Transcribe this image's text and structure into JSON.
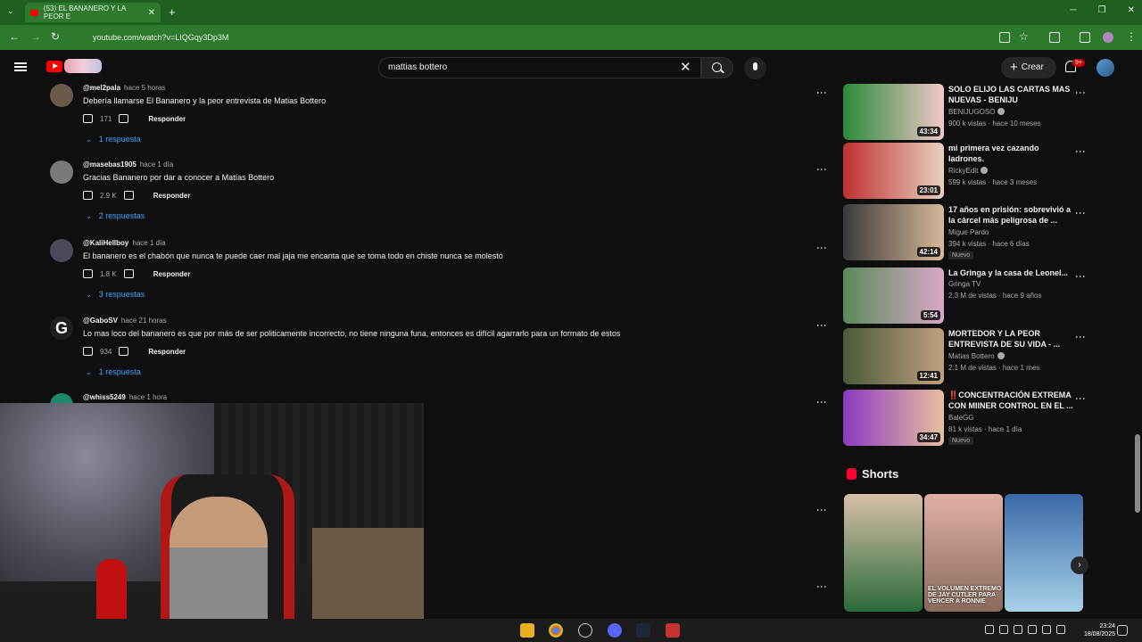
{
  "browser": {
    "tab_title": "(53) EL BANANERO Y LA PEOR E",
    "url": "youtube.com/watch?v=LIQGqy3Dp3M"
  },
  "header": {
    "search_value": "mattias bottero",
    "create_label": "Crear",
    "notif_count": "9+"
  },
  "comments": [
    {
      "user": "@mel2pala",
      "time": "hace 5 horas",
      "text": "Debería llamarse El Bananero y la peor entrevista de Matias Bottero",
      "likes": "171",
      "reply_label": "Responder",
      "replies": "1 respuesta"
    },
    {
      "user": "@masebas1905",
      "time": "hace 1 día",
      "text": "Gracias Bananero por dar a conocer a Matías Bottero",
      "likes": "2.9 K",
      "reply_label": "Responder",
      "replies": "2 respuestas"
    },
    {
      "user": "@KaliHellboy",
      "time": "hace 1 día",
      "text": "El bananero es el chabón que nunca te puede caer mal jaja me encanta que se toma todo en chiste nunca se molestó",
      "likes": "1.8 K",
      "reply_label": "Responder",
      "replies": "3 respuestas"
    },
    {
      "user": "@GaboSV",
      "time": "hace 21 horas",
      "text": "Lo mas loco del bananero es que por más de ser politicamente incorrecto, no tiene ninguna funa, entonces es difícil agarrarlo para un formato de estos",
      "likes": "934",
      "reply_label": "Responder",
      "replies": "1 respuesta"
    },
    {
      "user": "@whiss5249",
      "time": "hace 1 hora",
      "text": "",
      "likes": "",
      "reply_label": "",
      "replies": ""
    }
  ],
  "sidebar_videos": [
    {
      "title": "SOLO ELIJO LAS CARTAS MAS NUEVAS - BENIJU",
      "channel": "BENIJUGOSO",
      "meta": "900 k vistas · hace 10 meses",
      "duration": "43:34",
      "badge": "",
      "thumb_colors": [
        "#2a8a3a",
        "#f0c8c8"
      ]
    },
    {
      "title": "mi primera vez cazando ladrones.",
      "channel": "RickyEdit",
      "meta": "599 k vistas · hace 3 meses",
      "duration": "23:01",
      "badge": "",
      "thumb_colors": [
        "#c03030",
        "#e8d0c0"
      ]
    },
    {
      "title": "17 años en prisión: sobrevivió a la cárcel más peligrosa de ...",
      "channel": "Migue Pardo",
      "meta": "394 k vistas · hace 6 días",
      "duration": "42:14",
      "badge": "Nuevo",
      "thumb_colors": [
        "#3a3a3a",
        "#d8b898"
      ]
    },
    {
      "title": "La Gringa y la casa de Leonel...",
      "channel": "Gringa TV",
      "meta": "2.3 M de vistas · hace 9 años",
      "duration": "5:54",
      "badge": "",
      "thumb_colors": [
        "#5a8a5a",
        "#d8a8c8"
      ]
    },
    {
      "title": "MORTEDOR Y LA PEOR ENTREVISTA DE SU VIDA - ...",
      "channel": "Matias Bottero",
      "meta": "2.1 M de vistas · hace 1 mes",
      "duration": "12:41",
      "badge": "",
      "thumb_colors": [
        "#4a5a3a",
        "#c0a080"
      ]
    },
    {
      "title": "‼️CONCENTRACIÓN EXTREMA CON MIINER CONTROL EN EL ...",
      "channel": "BaleGG",
      "meta": "81 k vistas · hace 1 día",
      "duration": "34:47",
      "badge": "Nuevo",
      "thumb_colors": [
        "#8a3ac0",
        "#e8c0a0"
      ]
    }
  ],
  "shorts": {
    "heading": "Shorts",
    "items": [
      {
        "caption": "",
        "thumb_colors": [
          "#2a6a3a",
          "#d8c0a8"
        ]
      },
      {
        "caption": "EL VOLUMEN EXTREMO DE JAY CUTLER PARA VENCER A RONNIE",
        "thumb_colors": [
          "#8a6a5a",
          "#e0b0a8"
        ]
      },
      {
        "caption": "",
        "thumb_colors": [
          "#3a6aa8",
          "#a8d0e8"
        ]
      }
    ]
  },
  "taskbar": {
    "time": "23:24",
    "date": "18/08/2025"
  }
}
